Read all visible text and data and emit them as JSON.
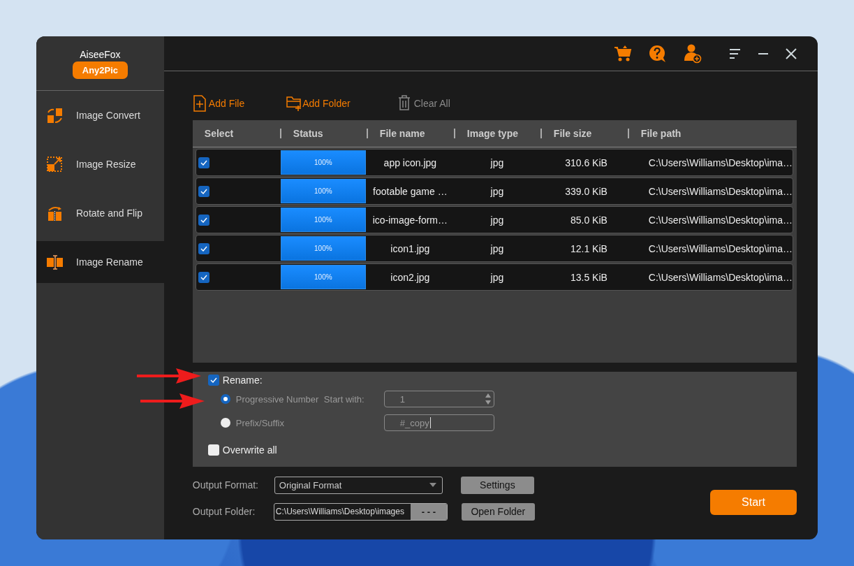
{
  "app": {
    "brand": "AiseeFox",
    "product": "Any2Pic"
  },
  "sidebar": {
    "items": [
      {
        "label": "Image Convert",
        "kind": "convert",
        "selected": false
      },
      {
        "label": "Image Resize",
        "kind": "resize",
        "selected": false
      },
      {
        "label": "Rotate and Flip",
        "kind": "rotate",
        "selected": false
      },
      {
        "label": "Image Rename",
        "kind": "rename",
        "selected": true
      }
    ]
  },
  "toolbar": [
    {
      "label": "Add File",
      "kind": "file",
      "disabled": false
    },
    {
      "label": "Add Folder",
      "kind": "folder",
      "disabled": false
    },
    {
      "label": "Clear All",
      "kind": "clear",
      "disabled": true
    }
  ],
  "table": {
    "columns": [
      "Select",
      "Status",
      "File name",
      "Image type",
      "File size",
      "File path"
    ],
    "rows": [
      {
        "checked": true,
        "level": 1,
        "reading": "100%",
        "name": "app icon.jpg",
        "type": "jpg",
        "size": "310.6 KiB",
        "path": "C:\\Users\\Williams\\Desktop\\ima…"
      },
      {
        "checked": true,
        "level": 1,
        "reading": "100%",
        "name": "footable game …",
        "type": "jpg",
        "size": "339.0 KiB",
        "path": "C:\\Users\\Williams\\Desktop\\ima…"
      },
      {
        "checked": true,
        "level": 1,
        "reading": "100%",
        "name": "ico-image-form…",
        "type": "jpg",
        "size": "85.0 KiB",
        "path": "C:\\Users\\Williams\\Desktop\\ima…"
      },
      {
        "checked": true,
        "level": 1,
        "reading": "100%",
        "name": "icon1.jpg",
        "type": "jpg",
        "size": "12.1 KiB",
        "path": "C:\\Users\\Williams\\Desktop\\ima…"
      },
      {
        "checked": true,
        "level": 1,
        "reading": "100%",
        "name": "icon2.jpg",
        "type": "jpg",
        "size": "13.5 KiB",
        "path": "C:\\Users\\Williams\\Desktop\\ima…"
      }
    ]
  },
  "rename": {
    "label": "Rename:",
    "checked": true,
    "options": [
      {
        "label": "Progressive Number",
        "selected": true,
        "field_label": "Start with:",
        "value": "1",
        "kind": "spinner"
      },
      {
        "label": "Prefix/Suffix",
        "selected": false,
        "value": "#_copy",
        "kind": "text"
      }
    ],
    "overwrite": {
      "label": "Overwrite all",
      "checked": false
    }
  },
  "output": {
    "format_label": "Output Format:",
    "format": "Original Format",
    "settings": "Settings",
    "folder_label": "Output Folder:",
    "folder": "C:\\Users\\Williams\\Desktop\\images",
    "browse": "- - -",
    "open_folder": "Open Folder"
  },
  "start": "Start"
}
